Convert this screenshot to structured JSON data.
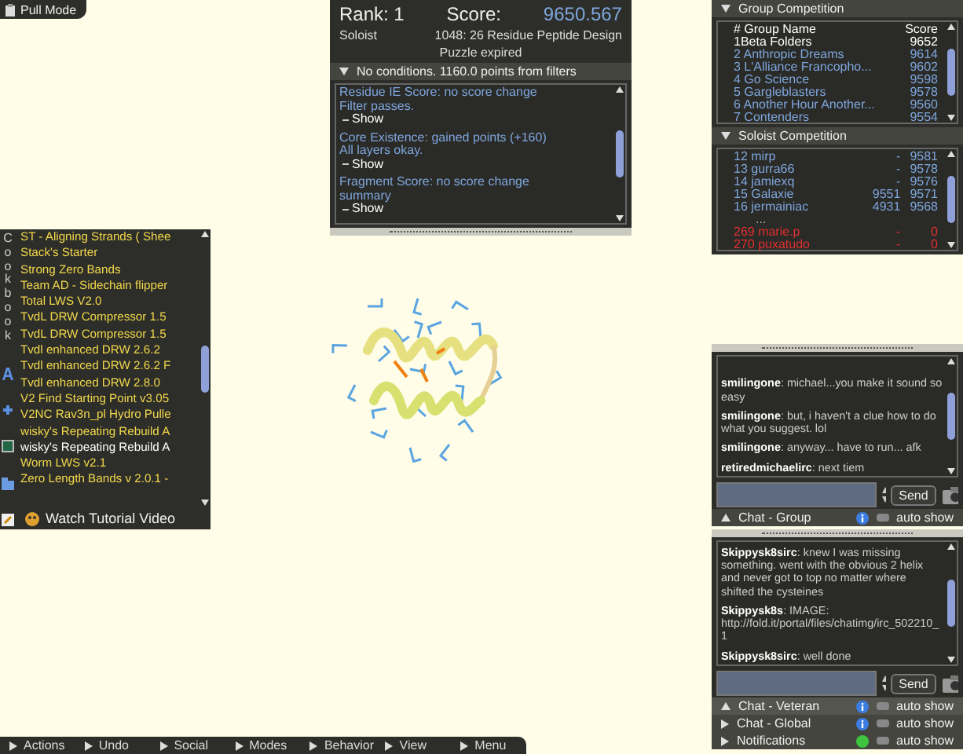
{
  "pull_mode": {
    "label": "Pull Mode"
  },
  "score_panel": {
    "rank": "Rank: 1",
    "score_label": "Score:",
    "score": "9650.567",
    "mode": "Soloist",
    "puzzle": "1048: 26 Residue Peptide Design",
    "status": "Puzzle expired",
    "filters_header": {
      "label": "No conditions. 1160.0 points from filters",
      "expanded": true
    },
    "filters": [
      {
        "title": "Residue IE Score: no score change",
        "detail": "Filter passes.",
        "button": "Show"
      },
      {
        "title": "Core Existence: gained points (+160)",
        "detail": "All layers okay.",
        "button": "Show"
      },
      {
        "title": "Fragment Score: no score change",
        "detail": "summary",
        "button": "Show"
      }
    ]
  },
  "group_competition": {
    "title": "Group Competition",
    "expanded": true,
    "columns": [
      "# Group Name",
      "Score"
    ],
    "rows": [
      {
        "name": "1Beta Folders",
        "score": "9652",
        "color": "#ffffff"
      },
      {
        "name": "2 Anthropic Dreams",
        "score": "9614",
        "color": "#7ea6dc"
      },
      {
        "name": "3 L'Alliance Francopho...",
        "score": "9602",
        "color": "#7ea6dc"
      },
      {
        "name": "4 Go Science",
        "score": "9598",
        "color": "#7ea6dc"
      },
      {
        "name": "5 Gargleblasters",
        "score": "9578",
        "color": "#7ea6dc"
      },
      {
        "name": "6 Another Hour Another...",
        "score": "9560",
        "color": "#7ea6dc"
      },
      {
        "name": "7 Contenders",
        "score": "9554",
        "color": "#7ea6dc"
      }
    ]
  },
  "soloist_competition": {
    "title": "Soloist Competition",
    "expanded": true,
    "rows": [
      {
        "name": "12 mirp",
        "group_score": "-",
        "score": "9581",
        "color": "#7ea6dc"
      },
      {
        "name": "13 gurra66",
        "group_score": "-",
        "score": "9578",
        "color": "#7ea6dc"
      },
      {
        "name": "14 jamiexq",
        "group_score": "-",
        "score": "9576",
        "color": "#7ea6dc"
      },
      {
        "name": "15 Galaxie",
        "group_score": "9551",
        "score": "9571",
        "color": "#7ea6dc"
      },
      {
        "name": "16 jermainiac",
        "group_score": "4931",
        "score": "9568",
        "color": "#7ea6dc"
      }
    ],
    "gap": "...",
    "bottom_rows": [
      {
        "name": "269 marie.p",
        "group_score": "-",
        "score": "0",
        "color": "#e03030"
      },
      {
        "name": "270 puxatudo",
        "group_score": "-",
        "score": "0",
        "color": "#e03030"
      }
    ]
  },
  "cookbook": {
    "title": "Cookbook",
    "recipes": [
      {
        "name": "ST - Aligning Strands ( Shee",
        "selected": false
      },
      {
        "name": "Stack's Starter",
        "selected": false
      },
      {
        "name": "Strong Zero Bands",
        "selected": false
      },
      {
        "name": "Team AD - Sidechain flipper",
        "selected": false
      },
      {
        "name": "Total LWS V2.0",
        "selected": false
      },
      {
        "name": "TvdL DRW Compressor 1.5",
        "selected": false
      },
      {
        "name": "TvdL DRW Compressor 1.5",
        "selected": false
      },
      {
        "name": "Tvdl enhanced DRW 2.6.2",
        "selected": false
      },
      {
        "name": "Tvdl enhanced DRW 2.6.2 F",
        "selected": false
      },
      {
        "name": "Tvdl enhanced DRW 2.8.0",
        "selected": false
      },
      {
        "name": "V2 Find Starting Point v3.05",
        "selected": false
      },
      {
        "name": "V2NC Rav3n_pl Hydro Pulle",
        "selected": false
      },
      {
        "name": "wisky's Repeating Rebuild A",
        "selected": false
      },
      {
        "name": "wisky's Repeating Rebuild A",
        "selected": true
      },
      {
        "name": "Worm LWS v2.1",
        "selected": false
      },
      {
        "name": "Zero Length Bands v 2.0.1 -",
        "selected": false
      }
    ],
    "tutorial": "Watch Tutorial Video"
  },
  "chat_group": {
    "messages": [
      "**smilingone**: michael...you make it sound so easy",
      "**smilingone**: but, i haven't a clue how to do what you suggest.  lol",
      "**smilingone**: anyway... have to run... afk",
      "**retiredmichaelirc**: next tiem"
    ],
    "send": "Send",
    "tabs": [
      {
        "label": "Chat - Group",
        "expanded": true,
        "kind": "info",
        "auto_show": "auto show",
        "auto_show_on": false,
        "selected": false
      }
    ]
  },
  "chat_veteran": {
    "messages": [
      "**Skippysk8sirc**: knew I was missing something. went with the obvious 2 helix and never got to top no matter where shifted the cysteines",
      "**Skippysk8s**: IMAGE: http://fold.it/portal/files/chatimg/irc_502210_1",
      "**Skippysk8sirc**: well done"
    ],
    "send": "Send",
    "tabs": [
      {
        "label": "Chat - Veteran",
        "expanded": true,
        "kind": "info",
        "auto_show": "auto show",
        "auto_show_on": false,
        "selected": true
      },
      {
        "label": "Chat - Global",
        "expanded": false,
        "kind": "info",
        "auto_show": "auto show",
        "auto_show_on": false,
        "selected": false
      },
      {
        "label": "Notifications",
        "expanded": false,
        "kind": "status",
        "auto_show": "auto show",
        "auto_show_on": false,
        "selected": false
      }
    ]
  },
  "menu_bar": [
    "Actions",
    "Undo",
    "Social",
    "Modes",
    "Behavior",
    "View",
    "Menu"
  ]
}
